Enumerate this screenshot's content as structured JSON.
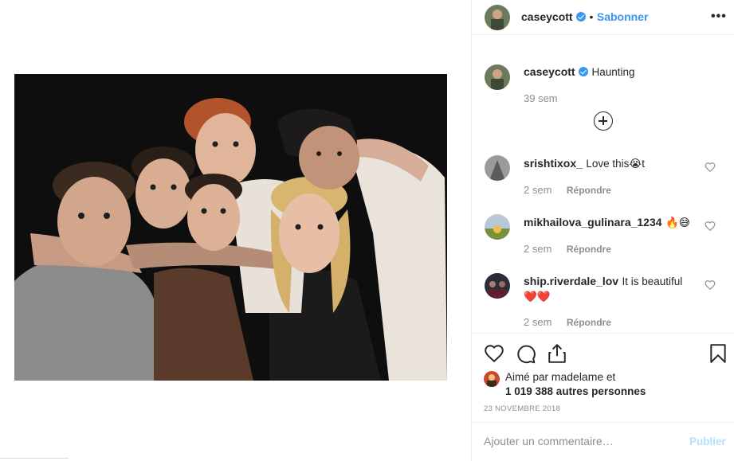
{
  "post": {
    "username": "caseycott",
    "follow_label": "Sabonner",
    "dot": "•",
    "more_icon": "more-horizontal-icon",
    "image_alt": "Group photo of six people with swapped faces"
  },
  "caption": {
    "username": "caseycott",
    "text": "Haunting",
    "time": "39 sem"
  },
  "load_more_icon": "plus-circle-icon",
  "comments": [
    {
      "username": "srishtixox_",
      "text": "Love this😭t",
      "time": "2 sem",
      "reply": "Répondre"
    },
    {
      "username": "mikhailova_gulinara_1234",
      "text": "🔥😅",
      "time": "2 sem",
      "reply": "Répondre"
    },
    {
      "username": "ship.riverdale_lov",
      "text": "It is beautiful",
      "text2": "❤️❤️",
      "time": "2 sem",
      "reply": "Répondre"
    }
  ],
  "actions": {
    "like_icon": "heart-icon",
    "comment_icon": "comment-icon",
    "share_icon": "share-icon",
    "save_icon": "bookmark-icon"
  },
  "likes": {
    "line1_prefix": "Aimé par",
    "liker": "madelame",
    "line1_suffix": "et",
    "line2": "1 019 388 autres personnes"
  },
  "date": "23 NOVEMBRE 2018",
  "add_comment": {
    "placeholder": "Ajouter un commentaire…",
    "publish": "Publier"
  },
  "colors": {
    "accent": "#3897f0",
    "publish_disabled": "#b2dffc",
    "muted": "#8e8e8e",
    "text": "#262626",
    "emoji_heart": "#e0245e"
  }
}
